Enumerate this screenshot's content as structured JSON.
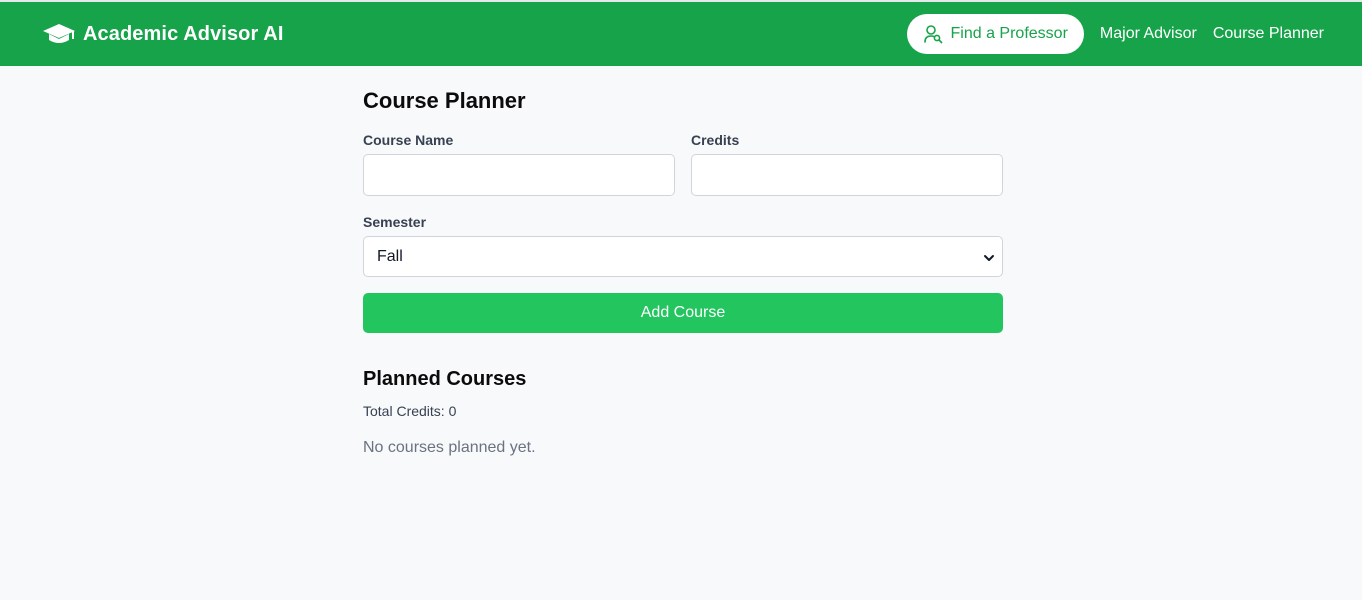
{
  "navbar": {
    "brand_title": "Academic Advisor AI",
    "brand_icon": "graduation-cap-icon",
    "find_professor_label": "Find a Professor",
    "find_professor_icon": "user-search-icon",
    "major_advisor_label": "Major Advisor",
    "course_planner_label": "Course Planner",
    "background_color": "#16a34a"
  },
  "planner": {
    "title": "Course Planner",
    "course_name_label": "Course Name",
    "course_name_value": "",
    "credits_label": "Credits",
    "credits_value": "",
    "semester_label": "Semester",
    "semester_selected": "Fall",
    "add_button_label": "Add Course",
    "button_color": "#22c55e"
  },
  "planned": {
    "title": "Planned Courses",
    "total_credits": "Total Credits: 0",
    "empty_message": "No courses planned yet."
  }
}
